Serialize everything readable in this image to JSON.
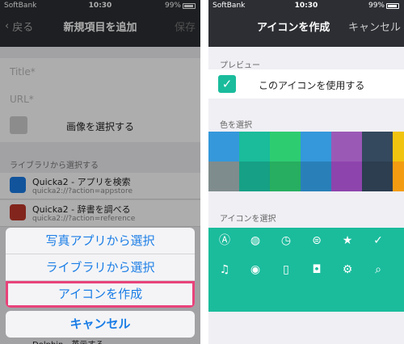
{
  "left": {
    "status": {
      "carrier": "SoftBank",
      "time": "10:30",
      "battery": "99%"
    },
    "nav": {
      "back": "戻る",
      "title": "新規項目を追加",
      "save": "保存"
    },
    "fields": {
      "title_placeholder": "Title*",
      "url_placeholder": "URL*"
    },
    "image_select": "画像を選択する",
    "library_section": "ライブラリから選択する",
    "library_items": [
      {
        "title": "Quicka2 - アプリを検索",
        "url": "quicka2://?action=appstore",
        "color": "#1a7de6"
      },
      {
        "title": "Quicka2 - 辞書を調べる",
        "url": "quicka2://?action=reference",
        "color": "#c0392b"
      }
    ],
    "sheet": {
      "photo": "写真アプリから選択",
      "library": "ライブラリから選択",
      "create": "アイコンを作成",
      "cancel": "キャンセル"
    },
    "peek": "Dolphin - 英示する"
  },
  "right": {
    "status": {
      "carrier": "SoftBank",
      "time": "10:30",
      "battery": "99%"
    },
    "nav": {
      "title": "アイコンを作成",
      "cancel": "キャンセル"
    },
    "preview_label": "プレビュー",
    "use_icon": "このアイコンを使用する",
    "color_label": "色を選択",
    "icon_label": "アイコンを選択",
    "colors_top": [
      "#3498db",
      "#1abc9c",
      "#2ecc71",
      "#3498db",
      "#9b59b6",
      "#34495e",
      "#f1c40f"
    ],
    "colors_bottom": [
      "#7f8c8d",
      "#16a085",
      "#27ae60",
      "#2980b9",
      "#8e44ad",
      "#2c3e50",
      "#f39c12"
    ],
    "icons_row1": [
      "app-store-icon",
      "globe-icon",
      "clock-icon",
      "toggle-icon",
      "star-icon",
      "checkmark-icon",
      "plus-icon"
    ],
    "icons_row2": [
      "music-icon",
      "record-icon",
      "book-icon",
      "notification-icon",
      "gear-icon",
      "search-icon",
      "more-icon"
    ]
  }
}
